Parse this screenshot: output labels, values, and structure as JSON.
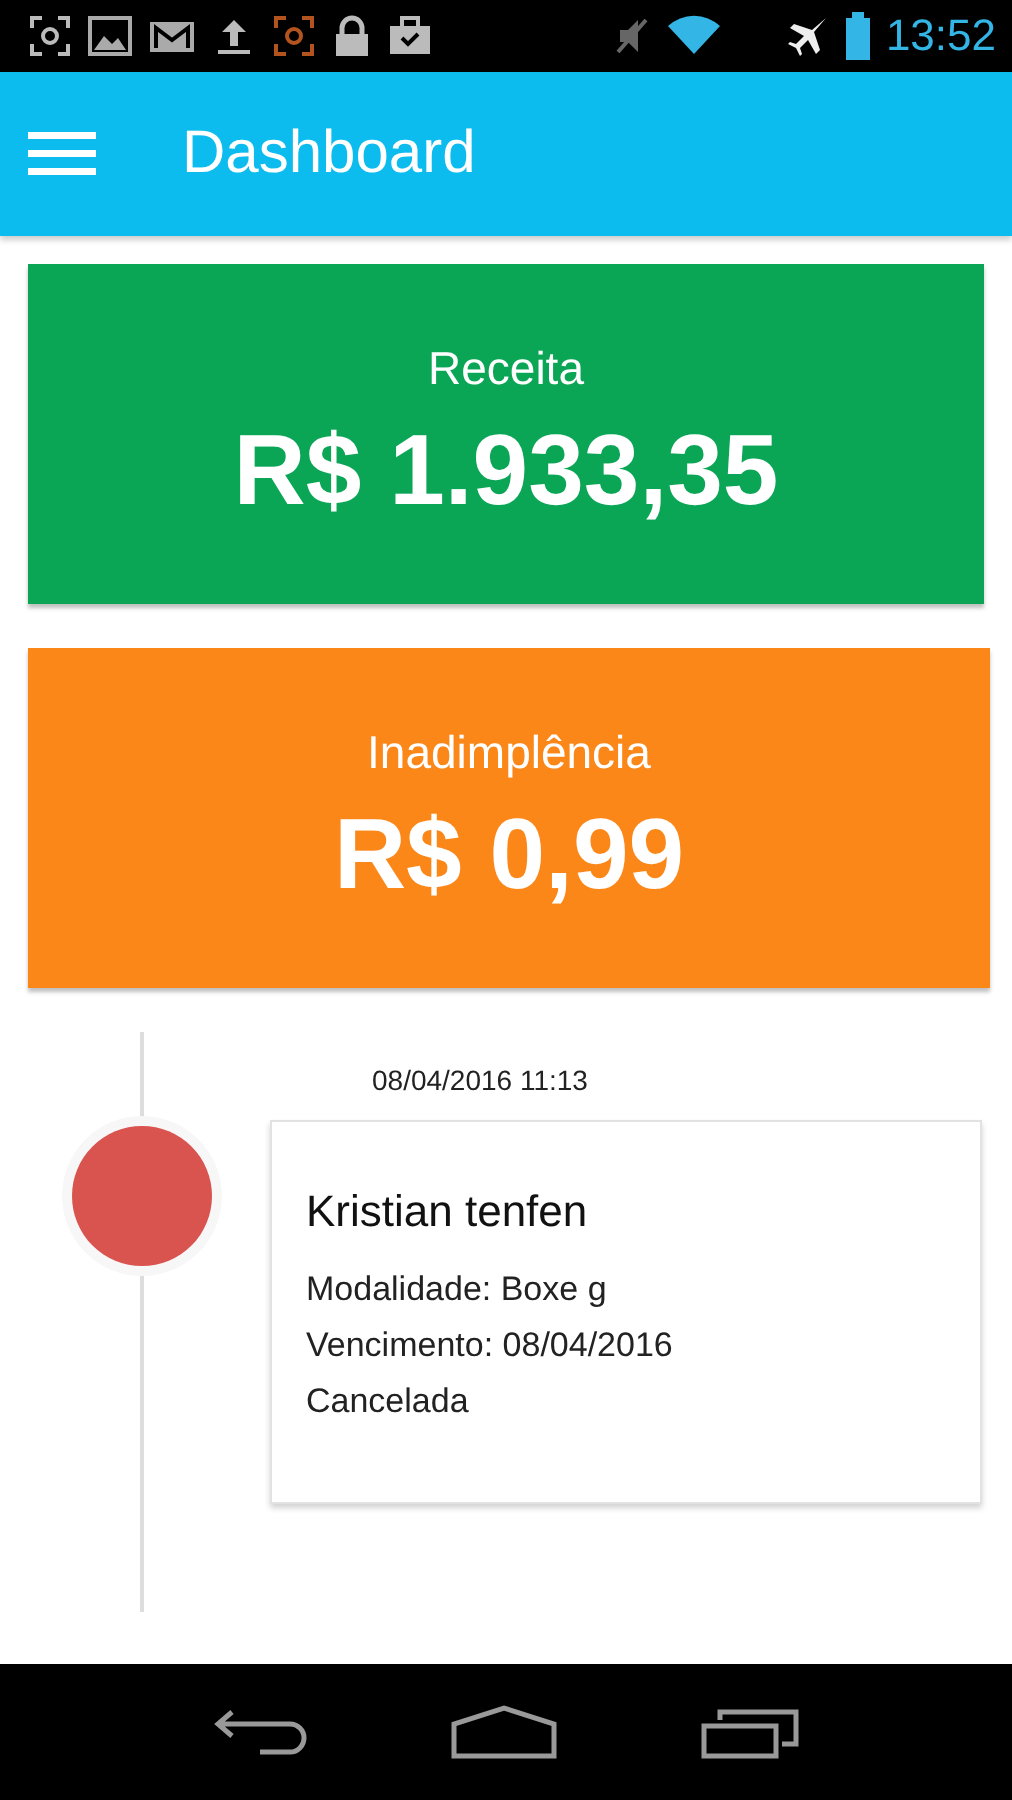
{
  "status_bar": {
    "time": "13:52"
  },
  "app_bar": {
    "title": "Dashboard"
  },
  "summary_cards": [
    {
      "label": "Receita",
      "value": "R$ 1.933,35",
      "color": "#0ba556"
    },
    {
      "label": "Inadimplência",
      "value": "R$ 0,99",
      "color": "#fb8719"
    }
  ],
  "timeline": [
    {
      "date": "08/04/2016 11:13",
      "color": "#d9534f",
      "name": "Kristian tenfen",
      "lines": [
        "Modalidade: Boxe g",
        "Vencimento: 08/04/2016",
        "Cancelada"
      ]
    }
  ]
}
